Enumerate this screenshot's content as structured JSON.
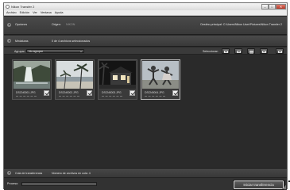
{
  "window": {
    "title": "Nikon Transfer 2",
    "controls": [
      "–",
      "□",
      "✕"
    ],
    "menu": [
      "Archivo",
      "Edición",
      "Ver",
      "Ventana",
      "Ayuda"
    ]
  },
  "destination": {
    "label": "Opciones",
    "origin_label": "Origen:",
    "origin_value": "NIKON",
    "primary_dest": "Destino principal: C:\\Users\\Nikon User\\Pictures\\Nikon Transfer 2"
  },
  "source": {
    "label": "Miniaturas",
    "count_text": "0 de 4 archivos seleccionados"
  },
  "toolbar": {
    "group_label": "Agrupar:",
    "group_value": "No agrupar",
    "select_label": "Seleccionar:"
  },
  "thumbnails": [
    {
      "file": "DSCN0001.JPG",
      "checked": true
    },
    {
      "file": "DSCN0002.JPG",
      "checked": true
    },
    {
      "file": "DSCN0003.JPG",
      "checked": true
    },
    {
      "file": "DSCN0004.JPG",
      "checked": true
    }
  ],
  "queue": {
    "label": "Cola de transferencia",
    "count_text": "Número de archivos en cola: 4"
  },
  "status": {
    "progress_label": "Proceso:",
    "progress_fraction": 0,
    "start_button": "Iniciar transferencia"
  },
  "colors": {
    "panel": "#2b2b2b",
    "bar": "#404040",
    "button_border": "#e8e8e8"
  }
}
